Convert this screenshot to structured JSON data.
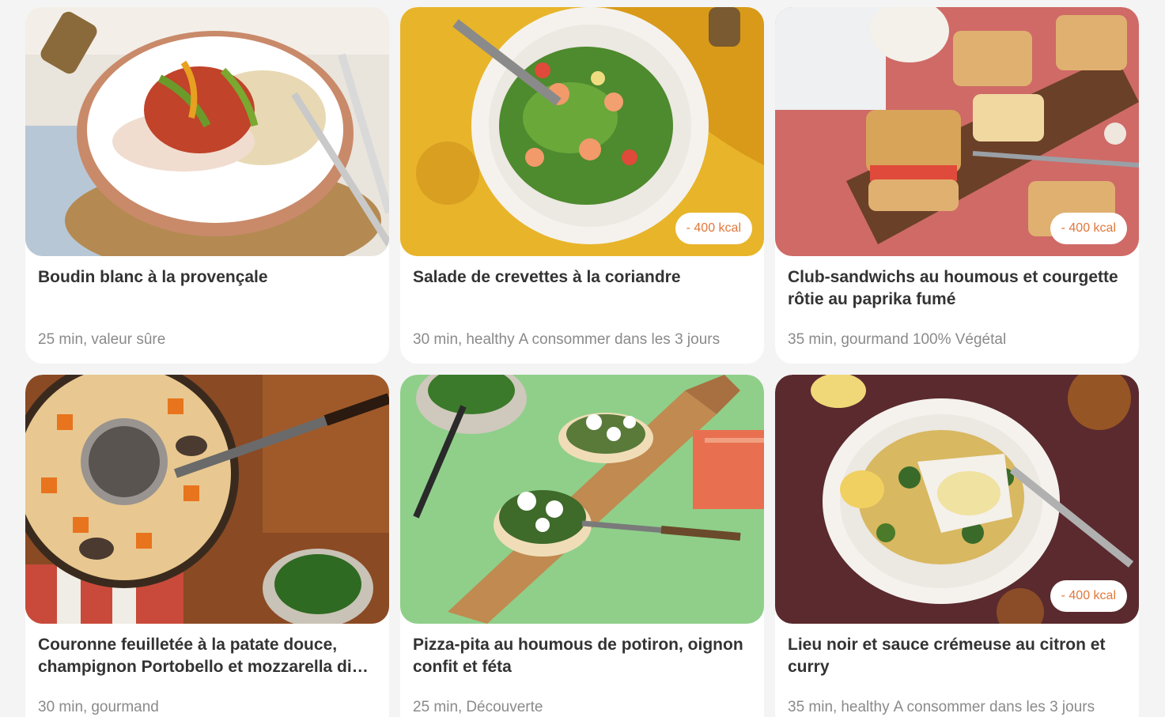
{
  "recipes": [
    {
      "title": "Boudin blanc à la provençale",
      "time": "25 min,",
      "tag": "valeur sûre",
      "extra": "",
      "kcal_badge": "",
      "image": "boudin-plate-photo"
    },
    {
      "title": "Salade de crevettes à la coriandre",
      "time": "30 min,",
      "tag": "healthy",
      "extra": "A consommer dans les 3 jours",
      "kcal_badge": "- 400 kcal",
      "image": "shrimp-salad-photo"
    },
    {
      "title": "Club-sandwichs au houmous et courgette rôtie au paprika fumé",
      "time": "35 min,",
      "tag": "gourmand",
      "extra": "100% Végétal",
      "kcal_badge": "- 400 kcal",
      "image": "club-sandwich-photo"
    },
    {
      "title": "Couronne feuilletée à la patate douce, champignon Portobello et mozzarella di bufala",
      "time": "30 min,",
      "tag": "gourmand",
      "extra": "",
      "kcal_badge": "",
      "image": "puff-pastry-crown-photo"
    },
    {
      "title": "Pizza-pita au houmous de potiron, oignon confit et féta",
      "time": "25 min,",
      "tag": "Découverte",
      "extra": "",
      "kcal_badge": "",
      "image": "pizza-pita-photo"
    },
    {
      "title": "Lieu noir et sauce crémeuse au citron et curry",
      "time": "35 min,",
      "tag": "healthy",
      "extra": "A consommer dans les 3 jours",
      "kcal_badge": "- 400 kcal",
      "image": "pollock-fish-photo"
    }
  ],
  "colors": {
    "kcal_text": "#e0783a",
    "title_text": "#333333",
    "meta_text": "#8a8a8a",
    "page_bg": "#f4f4f4"
  }
}
